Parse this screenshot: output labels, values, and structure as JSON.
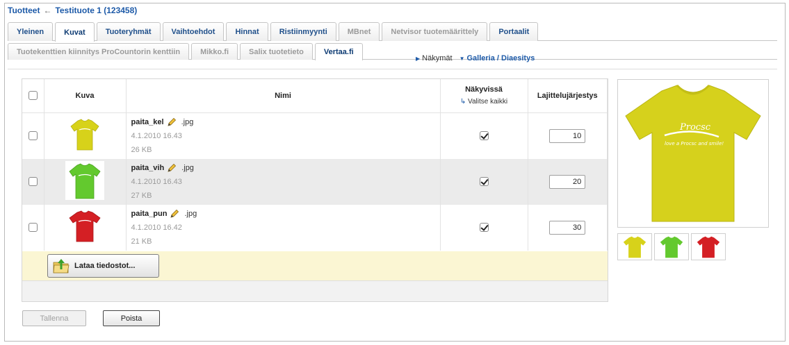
{
  "breadcrumb": {
    "root": "Tuotteet",
    "separator": "←",
    "current": "Testituote 1 (123458)"
  },
  "tabs_primary": [
    {
      "label": "Yleinen",
      "state": "normal"
    },
    {
      "label": "Kuvat",
      "state": "active"
    },
    {
      "label": "Tuoteryhmät",
      "state": "normal"
    },
    {
      "label": "Vaihtoehdot",
      "state": "normal"
    },
    {
      "label": "Hinnat",
      "state": "normal"
    },
    {
      "label": "Ristiinmyynti",
      "state": "normal"
    },
    {
      "label": "MBnet",
      "state": "disabled"
    },
    {
      "label": "Netvisor tuotemäärittely",
      "state": "disabled"
    },
    {
      "label": "Portaalit",
      "state": "normal"
    }
  ],
  "tabs_secondary": [
    {
      "label": "Tuotekenttien kiinnitys ProCountorin kenttiin",
      "state": "disabled"
    },
    {
      "label": "Mikko.fi",
      "state": "disabled"
    },
    {
      "label": "Salix tuotetieto",
      "state": "disabled"
    },
    {
      "label": "Vertaa.fi",
      "state": "active"
    }
  ],
  "views": {
    "label": "Näkymät",
    "selected": "Galleria / Diaesitys"
  },
  "table": {
    "headers": {
      "image": "Kuva",
      "name": "Nimi",
      "visible": "Näkyvissä",
      "select_all": "Valitse kaikki",
      "order": "Lajittelujärjestys"
    },
    "rows": [
      {
        "name": "paita_kel",
        "ext": ".jpg",
        "date": "4.1.2010 16.43",
        "size": "26 KB",
        "visible": true,
        "order": "10",
        "color": "#d7d21a"
      },
      {
        "name": "paita_vih",
        "ext": ".jpg",
        "date": "4.1.2010 16.43",
        "size": "27 KB",
        "visible": true,
        "order": "20",
        "color": "#63c92e"
      },
      {
        "name": "paita_pun",
        "ext": ".jpg",
        "date": "4.1.2010 16.42",
        "size": "21 KB",
        "visible": true,
        "order": "30",
        "color": "#d41f24"
      }
    ]
  },
  "upload": {
    "label": "Lataa tiedostot..."
  },
  "preview": {
    "shirt_text_1": "Procsc",
    "shirt_text_2": "love a Procsc and smile!"
  },
  "buttons": {
    "save": "Tallenna",
    "delete": "Poista"
  }
}
